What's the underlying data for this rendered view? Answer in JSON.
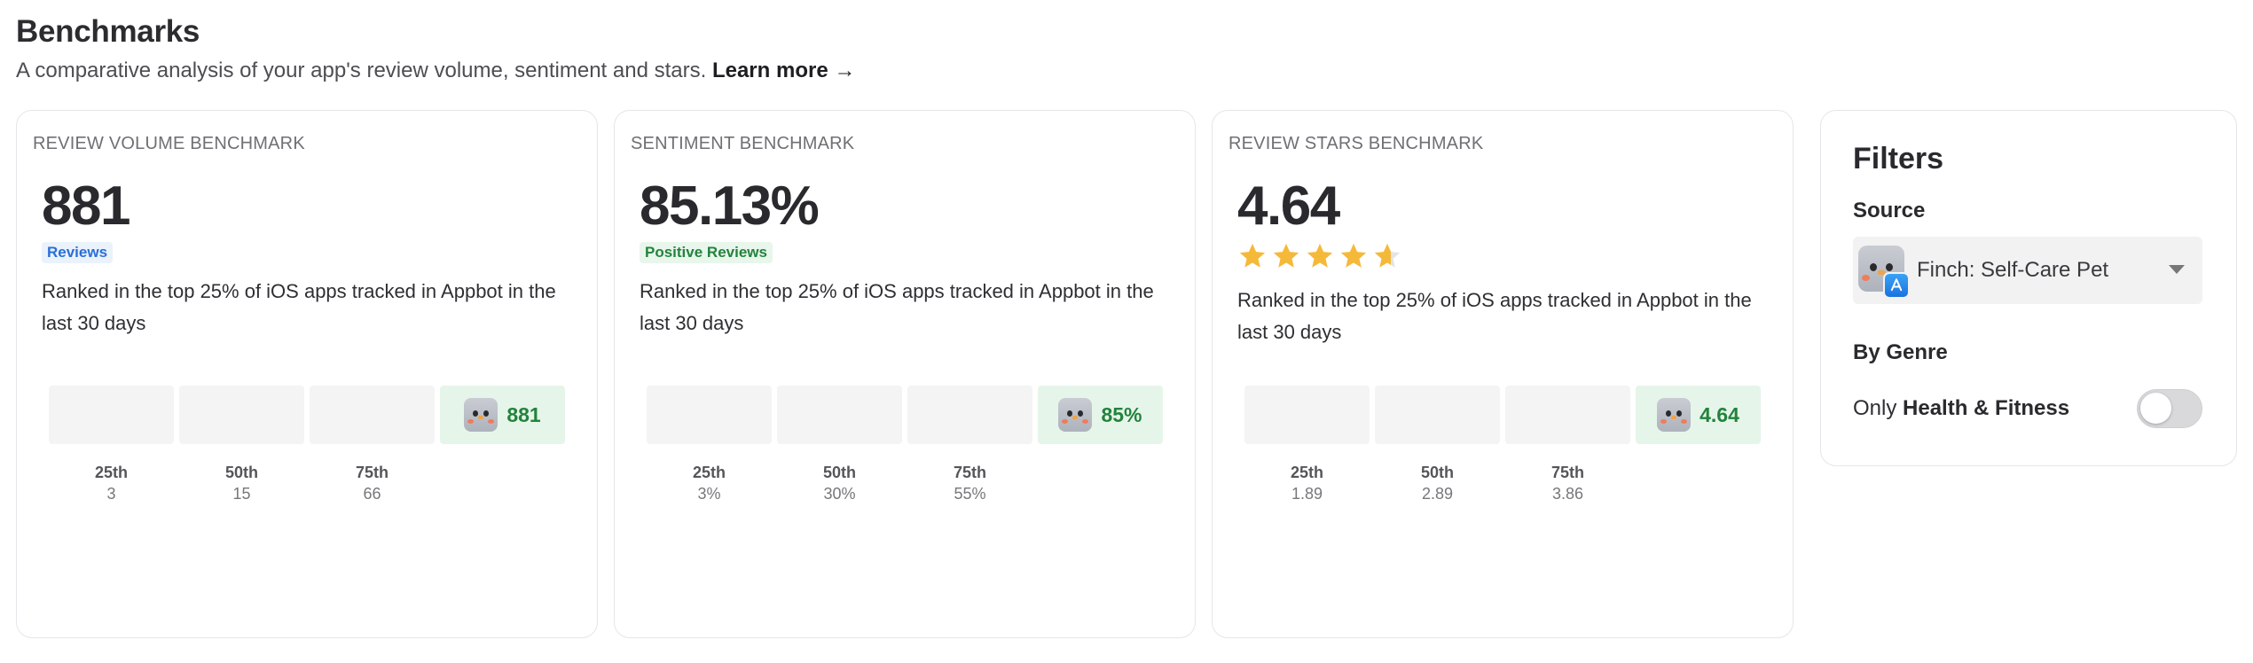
{
  "header": {
    "title": "Benchmarks",
    "subtitle": "A comparative analysis of your app's review volume, sentiment and stars.",
    "learn_more": "Learn more →"
  },
  "cards": [
    {
      "label": "REVIEW VOLUME BENCHMARK",
      "value": "881",
      "badge": "Reviews",
      "rank_text": "Ranked in the top 25% of iOS apps tracked in Appbot in the last 30 days",
      "active_value": "881",
      "ticks": [
        {
          "label": "25th",
          "value": "3"
        },
        {
          "label": "50th",
          "value": "15"
        },
        {
          "label": "75th",
          "value": "66"
        }
      ]
    },
    {
      "label": "SENTIMENT BENCHMARK",
      "value": "85.13%",
      "badge": "Positive Reviews",
      "rank_text": "Ranked in the top 25% of iOS apps tracked in Appbot in the last 30 days",
      "active_value": "85%",
      "ticks": [
        {
          "label": "25th",
          "value": "3%"
        },
        {
          "label": "50th",
          "value": "30%"
        },
        {
          "label": "75th",
          "value": "55%"
        }
      ]
    },
    {
      "label": "REVIEW STARS BENCHMARK",
      "value": "4.64",
      "stars_rating": 4.64,
      "rank_text": "Ranked in the top 25% of iOS apps tracked in Appbot in the last 30 days",
      "active_value": "4.64",
      "ticks": [
        {
          "label": "25th",
          "value": "1.89"
        },
        {
          "label": "50th",
          "value": "2.89"
        },
        {
          "label": "75th",
          "value": "3.86"
        }
      ]
    }
  ],
  "filters": {
    "title": "Filters",
    "source_heading": "Source",
    "source_value": "Finch: Self-Care Pet",
    "genre_heading": "By Genre",
    "toggle_prefix": "Only",
    "toggle_genre": "Health & Fitness",
    "toggle_on": false
  },
  "colors": {
    "star": "#f5b93a",
    "star_empty": "#e4e4e6",
    "active_bg": "#e6f5ea",
    "active_text": "#23833c",
    "badge_blue": "#2b6fd6"
  },
  "icons": {
    "app": "finch-app-icon",
    "store": "app-store-icon",
    "dropdown": "chevron-down-icon"
  }
}
